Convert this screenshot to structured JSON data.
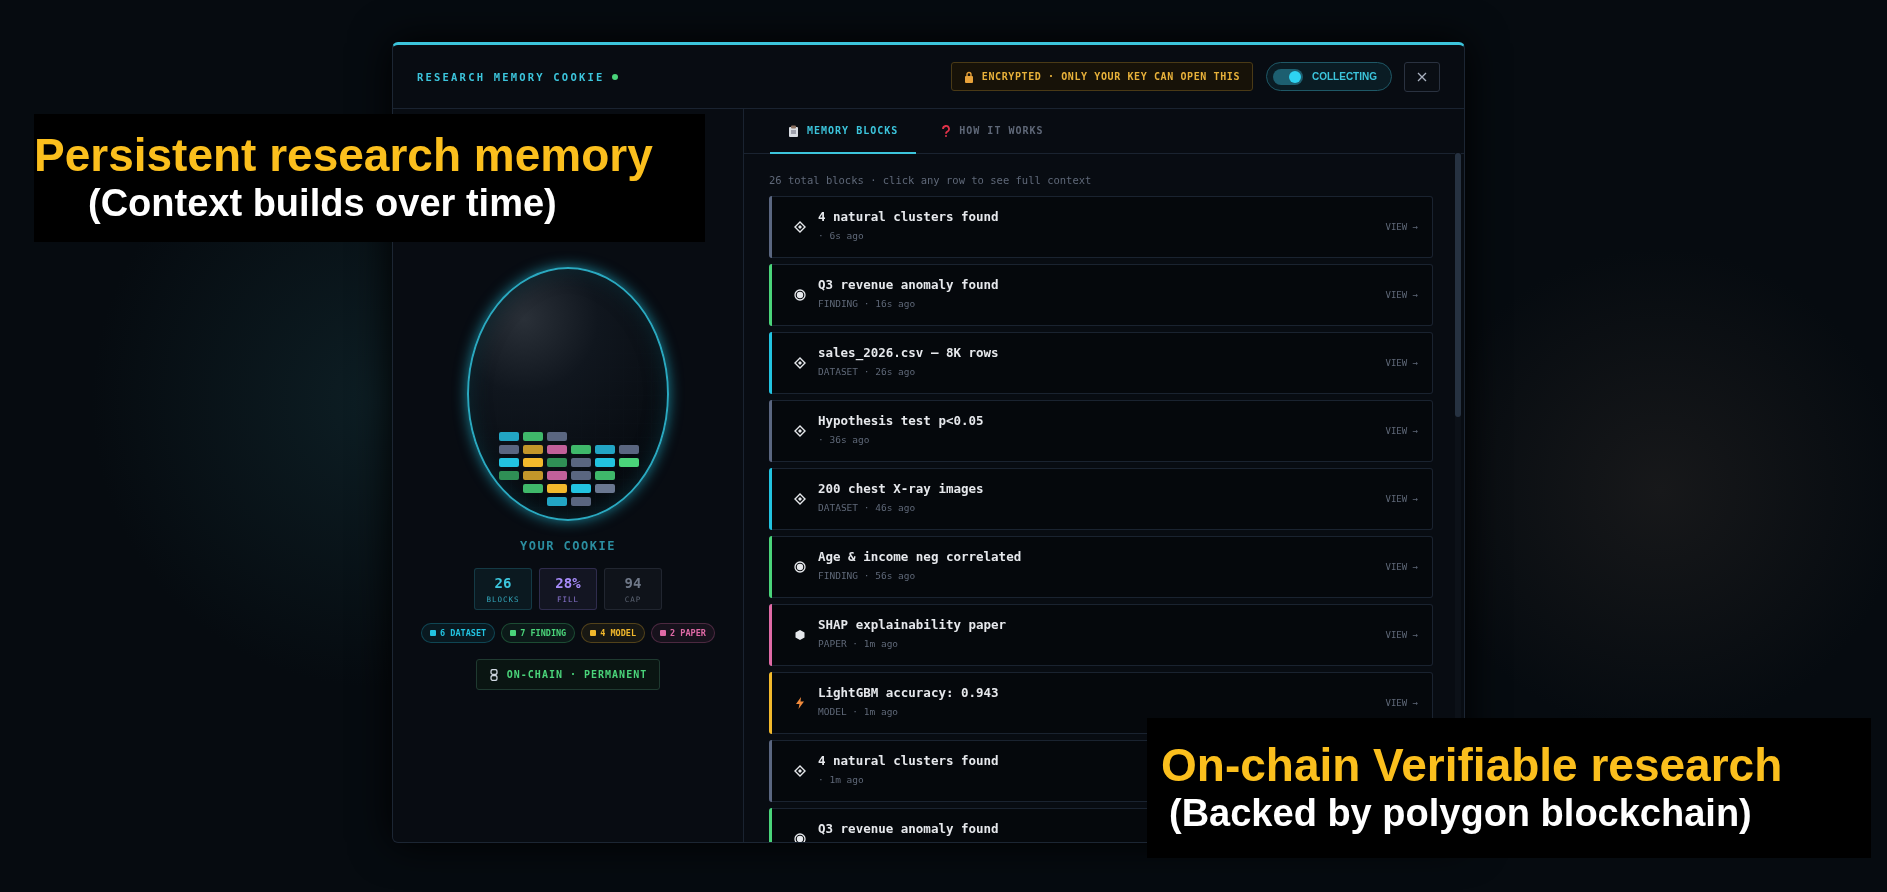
{
  "captions": [
    {
      "title": "Persistent research memory",
      "subtitle": "(Context builds over time)"
    },
    {
      "title": "On-chain Verifiable research",
      "subtitle": "(Backed by polygon blockchain)"
    }
  ],
  "header": {
    "title": "RESEARCH MEMORY COOKIE",
    "live": true,
    "badge": "ENCRYPTED · ONLY YOUR KEY CAN OPEN THIS",
    "toggle": {
      "label": "COLLECTING",
      "on": true
    }
  },
  "cookie": {
    "block_rows": [
      [
        {
          "color": "#22a5c4"
        },
        {
          "color": "#3fb86a"
        },
        {
          "color": "#5a6680"
        }
      ],
      [
        {
          "color": "#5a6680"
        },
        {
          "color": "#c2962a"
        },
        {
          "color": "#c2609a"
        },
        {
          "color": "#3fb86a"
        },
        {
          "color": "#22a5c4"
        },
        {
          "color": "#5a6680"
        }
      ],
      [
        {
          "color": "#22c3e0"
        },
        {
          "color": "#f2b92c"
        },
        {
          "color": "#2f8f55"
        },
        {
          "color": "#5a6680"
        },
        {
          "color": "#22c3e0"
        },
        {
          "color": "#4ad47a"
        }
      ],
      [
        {
          "color": "#2f8f55"
        },
        {
          "color": "#c2962a"
        },
        {
          "color": "#c2609a"
        },
        {
          "color": "#5a6680"
        },
        {
          "color": "#3fb86a"
        }
      ],
      [
        null,
        {
          "color": "#3fb86a"
        },
        {
          "color": "#f2b92c"
        },
        {
          "color": "#22c3e0"
        },
        {
          "color": "#6a7790"
        }
      ],
      [
        null,
        null,
        {
          "color": "#22a5c4"
        },
        {
          "color": "#5a6680"
        }
      ]
    ],
    "label": "YOUR COOKIE",
    "stats": [
      {
        "value": "26",
        "label": "BLOCKS",
        "color": "#3cc5dc"
      },
      {
        "value": "28%",
        "label": "FILL",
        "color": "#a78bfa"
      },
      {
        "value": "94",
        "label": "CAP",
        "color": "#6f7888"
      }
    ],
    "legend": [
      {
        "label": "6 DATASET",
        "color": "#22c3e0"
      },
      {
        "label": "7 FINDING",
        "color": "#4ad47a"
      },
      {
        "label": "4 MODEL",
        "color": "#f2b92c"
      },
      {
        "label": "2 PAPER",
        "color": "#e06aa6"
      }
    ],
    "chain_button": "ON-CHAIN · PERMANENT"
  },
  "tabs": [
    {
      "label": "MEMORY BLOCKS",
      "selected": true
    },
    {
      "label": "HOW IT WORKS",
      "selected": false
    }
  ],
  "hint": "26 total blocks · click any row to see full context",
  "blocks": [
    {
      "kind": "cluster",
      "title": "4 natural clusters found",
      "meta": "· 6s ago",
      "color": "#5a6680",
      "view": "VIEW →"
    },
    {
      "kind": "finding",
      "title": "Q3 revenue anomaly found",
      "meta": "FINDING · 16s ago",
      "color": "#4ad47a",
      "view": "VIEW →"
    },
    {
      "kind": "dataset",
      "title": "sales_2026.csv — 8K rows",
      "meta": "DATASET · 26s ago",
      "color": "#22c3e0",
      "view": "VIEW →"
    },
    {
      "kind": "test",
      "title": "Hypothesis test p<0.05",
      "meta": "· 36s ago",
      "color": "#5a6680",
      "view": "VIEW →"
    },
    {
      "kind": "dataset",
      "title": "200 chest X-ray images",
      "meta": "DATASET · 46s ago",
      "color": "#22c3e0",
      "view": "VIEW →"
    },
    {
      "kind": "finding",
      "title": "Age & income neg correlated",
      "meta": "FINDING · 56s ago",
      "color": "#4ad47a",
      "view": "VIEW →"
    },
    {
      "kind": "paper",
      "title": "SHAP explainability paper",
      "meta": "PAPER · 1m ago",
      "color": "#e06aa6",
      "view": "VIEW →"
    },
    {
      "kind": "model",
      "title": "LightGBM accuracy: 0.943",
      "meta": "MODEL · 1m ago",
      "color": "#f2b92c",
      "view": "VIEW →"
    },
    {
      "kind": "cluster",
      "title": "4 natural clusters found",
      "meta": "· 1m ago",
      "color": "#5a6680"
    },
    {
      "kind": "finding",
      "title": "Q3 revenue anomaly found",
      "color": "#4ad47a"
    }
  ]
}
